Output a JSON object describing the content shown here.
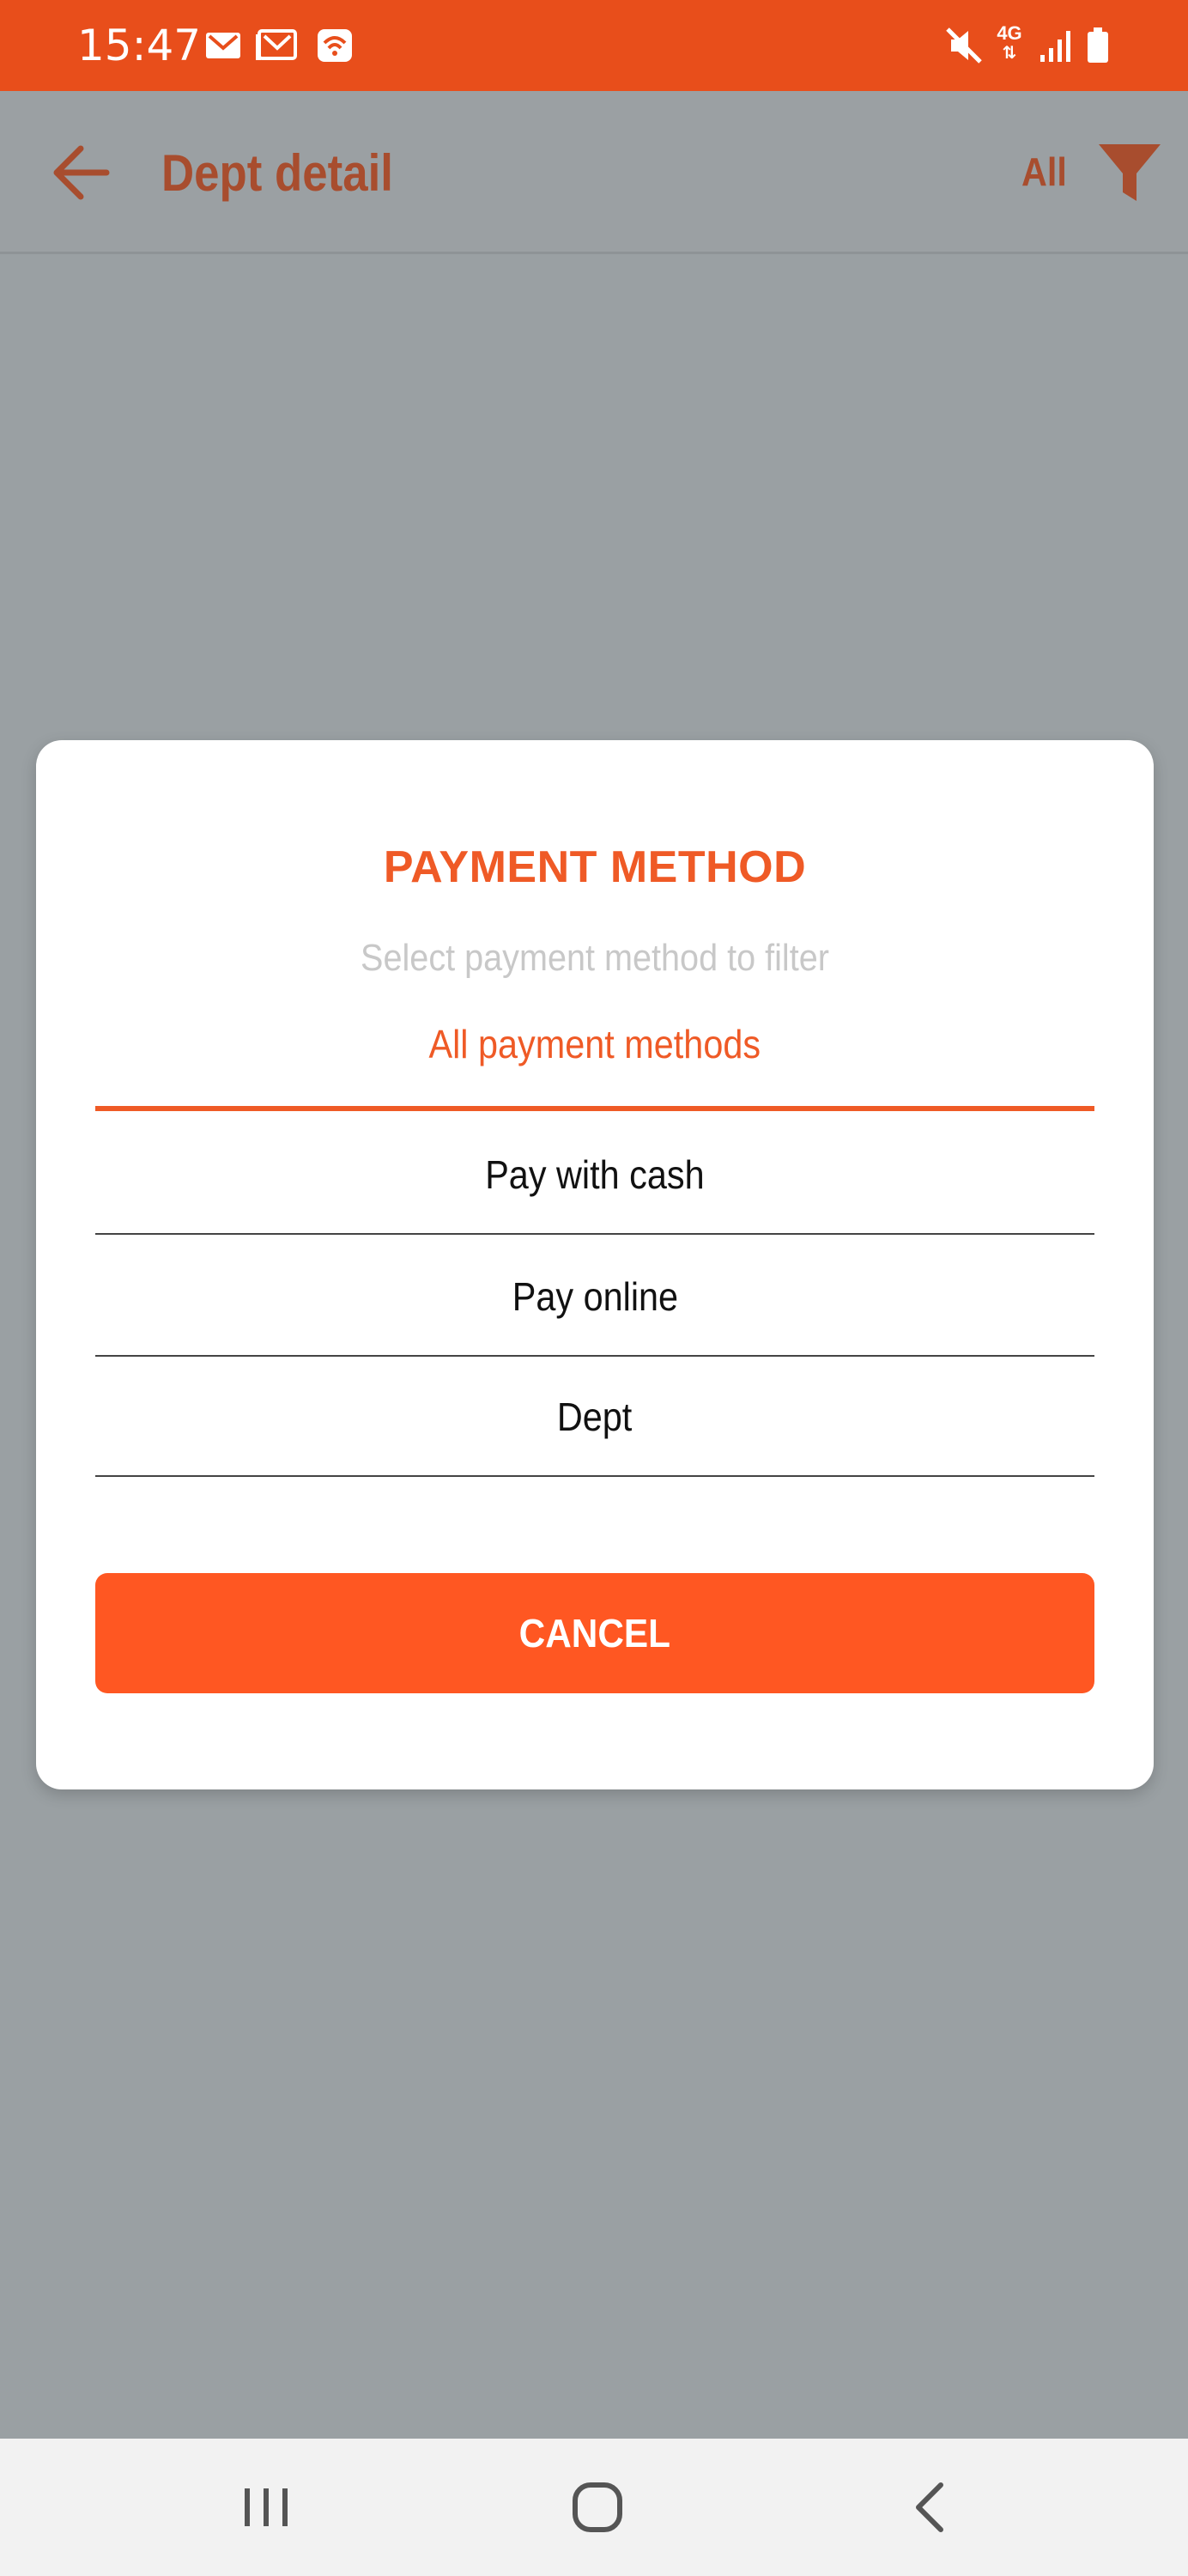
{
  "status_bar": {
    "time": "15:47",
    "left_icons": [
      "gmail-icon",
      "gmail-outline-icon",
      "wifi-calling-icon"
    ],
    "right_icons": [
      "mute-icon",
      "4g-data-icon",
      "signal-icon",
      "battery-icon"
    ],
    "network_label": "4G"
  },
  "app_bar": {
    "title": "Dept detail",
    "filter_label": "All",
    "back_icon": "arrow-left-icon",
    "filter_icon": "funnel-icon"
  },
  "dialog": {
    "title": "PAYMENT METHOD",
    "subtitle": "Select payment method to filter",
    "selected_option": "All payment methods",
    "options": [
      {
        "label": "Pay with cash"
      },
      {
        "label": "Pay online"
      },
      {
        "label": "Dept"
      }
    ],
    "cancel_label": "CANCEL"
  },
  "nav_bar": {
    "icons": [
      "recent-apps-icon",
      "home-icon",
      "back-icon"
    ]
  },
  "colors": {
    "accent": "#ef5a26",
    "status_bar": "#e84e1b",
    "button": "#ff5722",
    "scrim": "#9aa0a3"
  }
}
